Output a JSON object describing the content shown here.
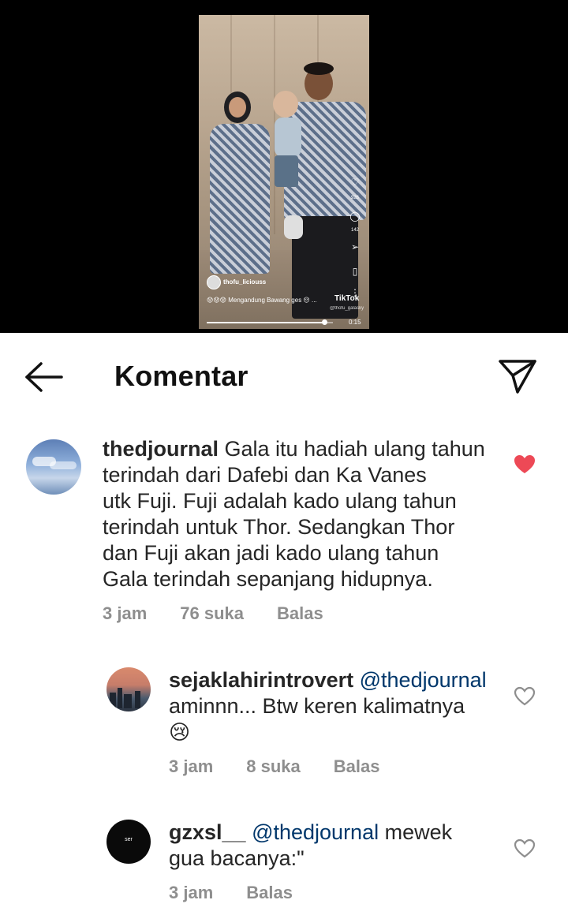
{
  "video": {
    "username": "thofu_liciouss",
    "caption": "😟😟😟 Mengandung Bawang ges 😔 ...",
    "tiktok_label": "TikTok",
    "tiktok_handle": "@thofu_galasky",
    "like_count": "926",
    "comment_count": "142",
    "time": "0:15",
    "progress": 0.93
  },
  "header": {
    "title": "Komentar"
  },
  "comments": [
    {
      "username": "thedjournal",
      "text_lines": [
        "Gala itu hadiah ulang tahun",
        "terindah dari Dafebi dan Ka Vanes",
        "utk Fuji. Fuji adalah kado ulang tahun",
        "terindah untuk Thor. Sedangkan Thor",
        "dan Fuji akan jadi kado ulang tahun",
        "Gala terindah sepanjang hidupnya."
      ],
      "time": "3 jam",
      "likes": "76 suka",
      "reply": "Balas",
      "liked": true
    },
    {
      "username": "sejaklahirintrovert",
      "mention": "@thedjournal",
      "text_line2": "aminnn... Btw keren kalimatnya",
      "emoji": "😢",
      "time": "3 jam",
      "likes": "8 suka",
      "reply": "Balas",
      "liked": false
    },
    {
      "username": "gzxsl__",
      "mention": "@thedjournal",
      "text_after_mention": "mewek",
      "text_line2": "gua bacanya:\"",
      "avatar_text": "ser",
      "time": "3 jam",
      "reply": "Balas",
      "liked": false
    }
  ],
  "colors": {
    "heart_liked": "#ed4956",
    "meta_gray": "#8e8e8e",
    "mention_blue": "#00376b"
  }
}
